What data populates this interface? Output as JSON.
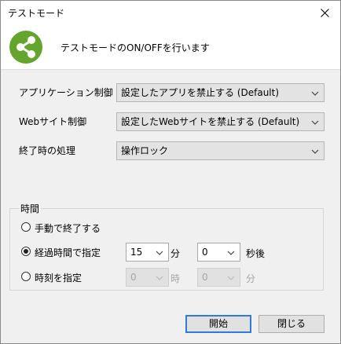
{
  "window": {
    "title": "テストモード"
  },
  "header": {
    "text": "テストモードのON/OFFを行います",
    "logo_icon": "share-icon",
    "logo_color": "#63a52d"
  },
  "fields": {
    "app_control": {
      "label": "アプリケーション制御",
      "value": "設定したアプリを禁止する (Default)"
    },
    "web_control": {
      "label": "Webサイト制御",
      "value": "設定したWebサイトを禁止する (Default)"
    },
    "end_action": {
      "label": "終了時の処理",
      "value": "操作ロック"
    }
  },
  "time_group": {
    "title": "時間",
    "options": [
      {
        "label": "手動で終了する",
        "selected": false
      },
      {
        "label": "経過時間で指定",
        "selected": true
      },
      {
        "label": "時刻を指定",
        "selected": false
      }
    ],
    "elapsed": {
      "minutes": "15",
      "minutes_unit": "分",
      "seconds": "0",
      "seconds_unit": "秒後"
    },
    "clock": {
      "hour": "0",
      "hour_unit": "時",
      "minute": "0",
      "minute_unit": "分"
    }
  },
  "buttons": {
    "start": "開始",
    "close": "閉じる"
  },
  "colors": {
    "primary_border": "#2f7bd7"
  }
}
